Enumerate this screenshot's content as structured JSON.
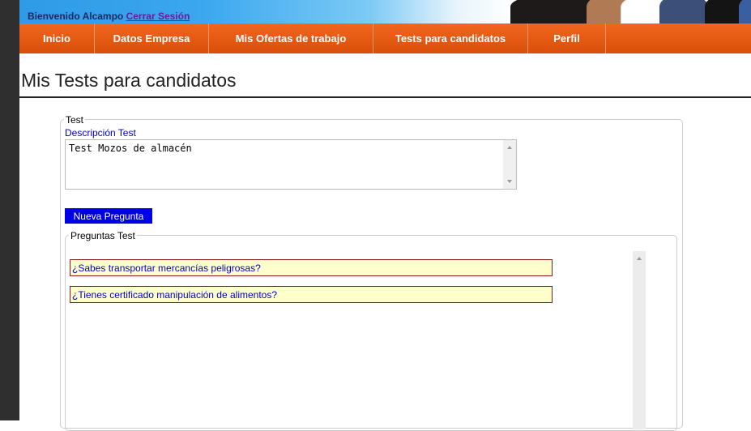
{
  "header": {
    "welcome_text": "Bienvenido Alcampo",
    "logout_link": "Cerrar Sesión"
  },
  "nav": {
    "items": [
      "Inicio",
      "Datos Empresa",
      "Mis Ofertas de trabajo",
      "Tests para candidatos",
      "Perfil"
    ]
  },
  "page": {
    "title": "Mis Tests para candidatos"
  },
  "test_form": {
    "legend": "Test",
    "description_label": "Descripción Test",
    "description_value": "Test Mozos de almacén",
    "new_question_button": "Nueva Pregunta"
  },
  "questions": {
    "legend": "Preguntas Test",
    "items": [
      "¿Sabes transportar mercancías peligrosas?",
      "¿Tienes certificado manipulación de alimentos?"
    ]
  },
  "colors": {
    "nav_bg": "#e85c14",
    "button_bg": "#0000e6",
    "question_bg": "#ffffcc",
    "question_border": "#8b1a1a",
    "link_blue": "#0000cc"
  }
}
